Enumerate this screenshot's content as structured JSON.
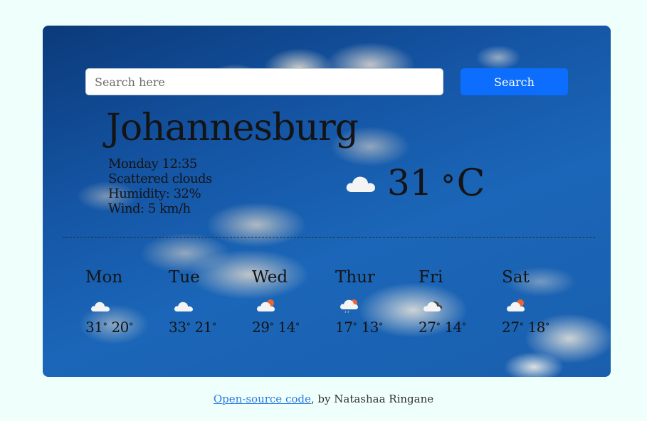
{
  "search": {
    "placeholder": "Search here",
    "button_label": "Search"
  },
  "current": {
    "city": "Johannesburg",
    "datetime": "Monday 12:35",
    "description": "Scattered clouds",
    "humidity": "Humidity: 32%",
    "wind": "Wind: 5 km/h",
    "temperature": "31",
    "degree_symbol": "°",
    "unit": "C",
    "icon": "cloud-icon"
  },
  "forecast": [
    {
      "day": "Mon",
      "max": "31",
      "min": "20",
      "icon": "cloud-icon"
    },
    {
      "day": "Tue",
      "max": "33",
      "min": "21",
      "icon": "cloud-icon"
    },
    {
      "day": "Wed",
      "max": "29",
      "min": "14",
      "icon": "partly-cloudy-icon"
    },
    {
      "day": "Thur",
      "max": "17",
      "min": "13",
      "icon": "rain-cloud-icon"
    },
    {
      "day": "Fri",
      "max": "27",
      "min": "14",
      "icon": "dark-cloud-icon"
    },
    {
      "day": "Sat",
      "max": "27",
      "min": "18",
      "icon": "partly-cloudy-icon"
    }
  ],
  "forecast_degree_symbol": "°",
  "footer": {
    "link_text": "Open-source code",
    "suffix": ", by Natashaa Ringane"
  },
  "colors": {
    "page_background": "#effffb",
    "button": "#0d6efd",
    "link": "#2a7ae2"
  }
}
